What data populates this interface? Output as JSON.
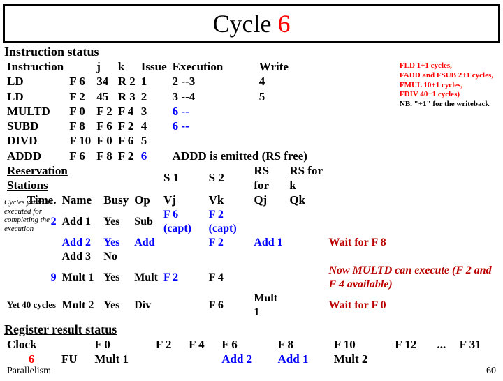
{
  "title": {
    "a": "Cycle ",
    "b": "6"
  },
  "sections": {
    "instatus": "Instruction status",
    "resv": "Reservation Stations",
    "regres": "Register result status"
  },
  "ih": {
    "inst": "Instruction",
    "j": "j",
    "k": "k",
    "iss": "Issue",
    "exe": "Execution",
    "wr": "Write"
  },
  "irows": [
    {
      "op": "LD",
      "d": "F 6",
      "j": "34",
      "k": "R 2",
      "is": "1",
      "ex": "2 --3",
      "wr": "4"
    },
    {
      "op": "LD",
      "d": "F 2",
      "j": "45",
      "k": "R 3",
      "is": "2",
      "ex": "3 --4",
      "wr": "5"
    },
    {
      "op": "MULTD",
      "d": "F 0",
      "j": "F 2",
      "k": "F 4",
      "is": "3",
      "ex": "6 --",
      "wr": ""
    },
    {
      "op": "SUBD",
      "d": "F 8",
      "j": "F 6",
      "k": "F 2",
      "is": "4",
      "ex": "6 --",
      "wr": ""
    },
    {
      "op": "DIVD",
      "d": "F 10",
      "j": "F 0",
      "k": "F 6",
      "is": "5",
      "ex": "",
      "wr": ""
    },
    {
      "op": "ADDD",
      "d": "F 6",
      "j": "F 8",
      "k": "F 2",
      "is": "6",
      "ex": "",
      "wr": ""
    }
  ],
  "adddnote": "ADDD is emitted (RS free)",
  "latnote": {
    "l1": "FLD 1+1 cycles,",
    "l2": "FADD and FSUB 2+1 cycles,",
    "l3": "FMUL 10+1 cycles,",
    "l4": "FDIV 40+1 cycles)",
    "l5": "NB. \"+1\" for the writeback"
  },
  "rh": {
    "s1": "S 1",
    "s2": "S 2",
    "rsj": "RS for",
    "rsk": "RS for k",
    "time": "Time.",
    "name": "Name",
    "busy": "Busy",
    "op": "Op",
    "vj": "Vj",
    "vk": "Vk",
    "qj": "Qj",
    "qk": "Qk"
  },
  "rs": [
    {
      "t": "2",
      "n": "Add 1",
      "b": "Yes",
      "op": "Sub",
      "vj": "F 6 (capt)",
      "vk": "F 2 (capt)",
      "qj": "",
      "qk": "",
      "note": ""
    },
    {
      "t": "",
      "n": "Add 2",
      "b": "Yes",
      "op": "Add",
      "vj": "",
      "vk": "F 2",
      "qj": "Add 1",
      "qk": "",
      "note": "Wait for F 8"
    },
    {
      "t": "",
      "n": "Add 3",
      "b": "No",
      "op": "",
      "vj": "",
      "vk": "",
      "qj": "",
      "qk": "",
      "note": ""
    },
    {
      "t": "9",
      "n": "Mult 1",
      "b": "Yes",
      "op": "Mult",
      "vj": "F 2",
      "vk": "F 4",
      "qj": "",
      "qk": "",
      "note": "Now MULTD can execute (F 2 and F 4 available)"
    },
    {
      "t": "",
      "n": "Mult 2",
      "b": "Yes",
      "op": "Div",
      "vj": "",
      "vk": "F 6",
      "qj": "Mult 1",
      "qk": "",
      "note": "Wait for F 0"
    }
  ],
  "yet40": "Yet 40 cycles",
  "cycnote": "Cycles yet to be executed for completing the execution",
  "reg": {
    "clock": "Clock",
    "clockv": "6",
    "fu": "FU",
    "cols": [
      "F 0",
      "F 2",
      "F 4",
      "F 6",
      "F 8",
      "F 10",
      "F 12",
      "...",
      "F 31"
    ],
    "vals": [
      "Mult 1",
      "",
      "",
      "Add 2",
      "Add 1",
      "Mult 2",
      "",
      "",
      ""
    ]
  },
  "foot": {
    "l": "Parallelism",
    "r": "60"
  }
}
